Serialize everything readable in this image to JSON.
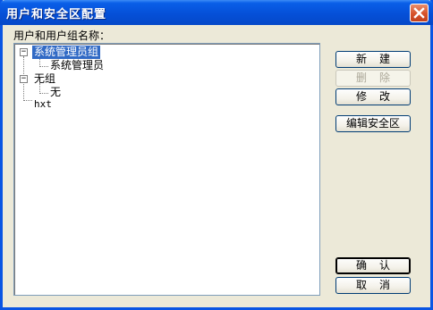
{
  "window": {
    "title": "用户和安全区配置"
  },
  "list_label": "用户和用户组名称：",
  "tree": {
    "items": [
      {
        "label": "系统管理员组",
        "selected": true,
        "expanded": true
      },
      {
        "label": "系统管理员"
      },
      {
        "label": "无组",
        "expanded": true
      },
      {
        "label": "无"
      },
      {
        "label": "hxt"
      }
    ],
    "expander_glyph": "−"
  },
  "buttons": {
    "new": "新建",
    "delete": "删除",
    "modify": "修改",
    "edit_security_zone": "编辑安全区",
    "ok": "确认",
    "cancel": "取消"
  },
  "icons": {
    "close": "close-icon"
  },
  "colors": {
    "titlebar": "#0550d8",
    "selection": "#316ac5",
    "dialog_bg": "#ece9d8",
    "close_button": "#d6522a"
  }
}
